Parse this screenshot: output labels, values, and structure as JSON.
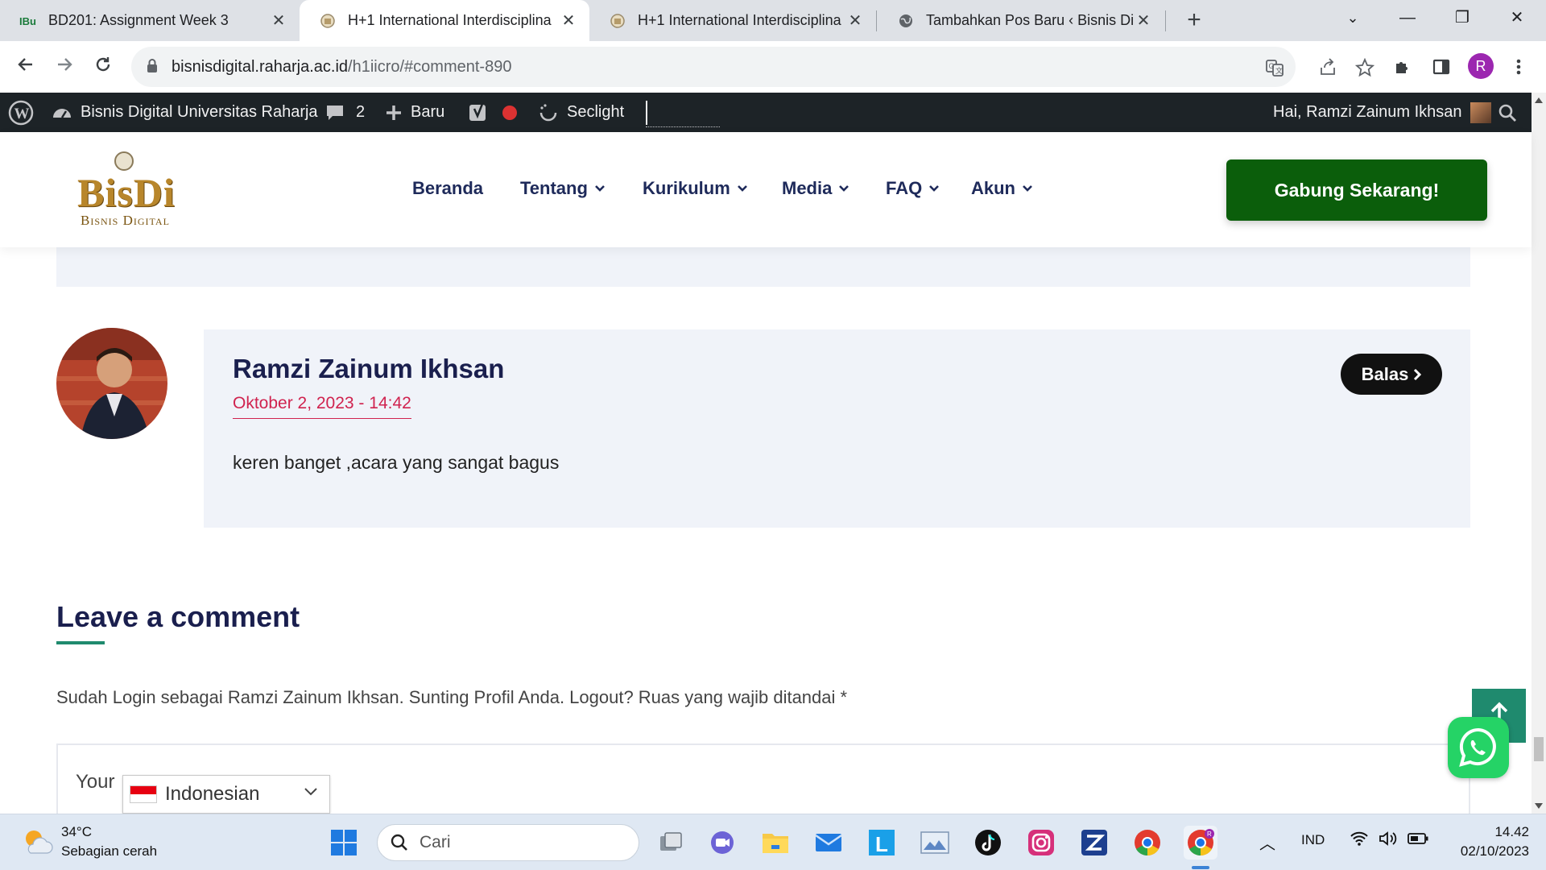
{
  "browser": {
    "tabs": [
      {
        "title": "BD201: Assignment Week 3",
        "favicon": "ibu-icon",
        "active": false
      },
      {
        "title": "H+1 International Interdisciplina",
        "favicon": "emblem-icon",
        "active": true
      },
      {
        "title": "H+1 International Interdisciplina",
        "favicon": "emblem-icon",
        "active": false
      },
      {
        "title": "Tambahkan Pos Baru ‹ Bisnis Dig",
        "favicon": "globe-icon",
        "active": false
      }
    ],
    "url_host": "bisnisdigital.raharja.ac.id",
    "url_path": "/h1iicro/#comment-890",
    "profile_initial": "R"
  },
  "adminbar": {
    "site_name": "Bisnis Digital Universitas Raharja",
    "comments_count": "2",
    "new_label": "Baru",
    "seclight_label": "Seclight",
    "greeting": "Hai, Ramzi Zainum Ikhsan"
  },
  "site": {
    "logo_big": "BisDi",
    "logo_small": "Bisnis Digital",
    "menu": [
      "Beranda",
      "Tentang",
      "Kurikulum",
      "Media",
      "FAQ",
      "Akun"
    ],
    "cta": "Gabung Sekarang!"
  },
  "comment": {
    "author": "Ramzi Zainum Ikhsan",
    "date": "Oktober 2, 2023 - 14:42",
    "text": "keren banget ,acara yang sangat bagus",
    "reply_label": "Balas"
  },
  "form": {
    "title": "Leave a comment",
    "logged_in_text": "Sudah Login sebagai Ramzi Zainum Ikhsan. Sunting Profil Anda. Logout? Ruas yang wajib ditandai *",
    "field_label": "Your",
    "language": "Indonesian"
  },
  "taskbar": {
    "temperature": "34°C",
    "weather": "Sebagian cerah",
    "search_placeholder": "Cari",
    "language": "IND",
    "time": "14.42",
    "date": "02/10/2023"
  },
  "colors": {
    "cta": "#0b5e0b",
    "date": "#d0234f",
    "heading": "#1a1f4e",
    "accent": "#1f8a6e"
  }
}
